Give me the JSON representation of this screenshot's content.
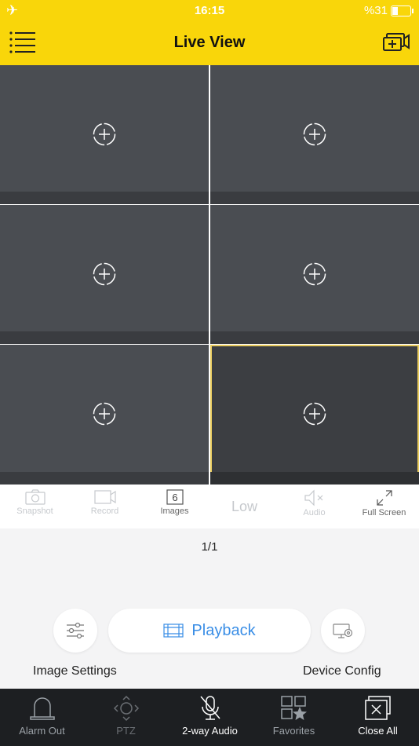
{
  "status_bar": {
    "time": "16:15",
    "battery": "%31",
    "battery_level": 0.31
  },
  "header": {
    "title": "Live View"
  },
  "grid": {
    "cells": 6,
    "selected_index": 5
  },
  "toolbar": {
    "snapshot": "Snapshot",
    "record": "Record",
    "images": "Images",
    "images_count": "6",
    "quality": "Low",
    "audio": "Audio",
    "full_screen": "Full Screen"
  },
  "page_indicator": "1/1",
  "actions": {
    "playback": "Playback",
    "image_settings": "Image Settings",
    "device_config": "Device Config"
  },
  "bottom_bar": {
    "alarm_out": "Alarm Out",
    "ptz": "PTZ",
    "two_way_audio": "2-way Audio",
    "favorites": "Favorites",
    "close_all": "Close All"
  },
  "colors": {
    "accent": "#f9d60a",
    "link": "#3a8ee6",
    "selected_border": "#e9cc5f"
  }
}
